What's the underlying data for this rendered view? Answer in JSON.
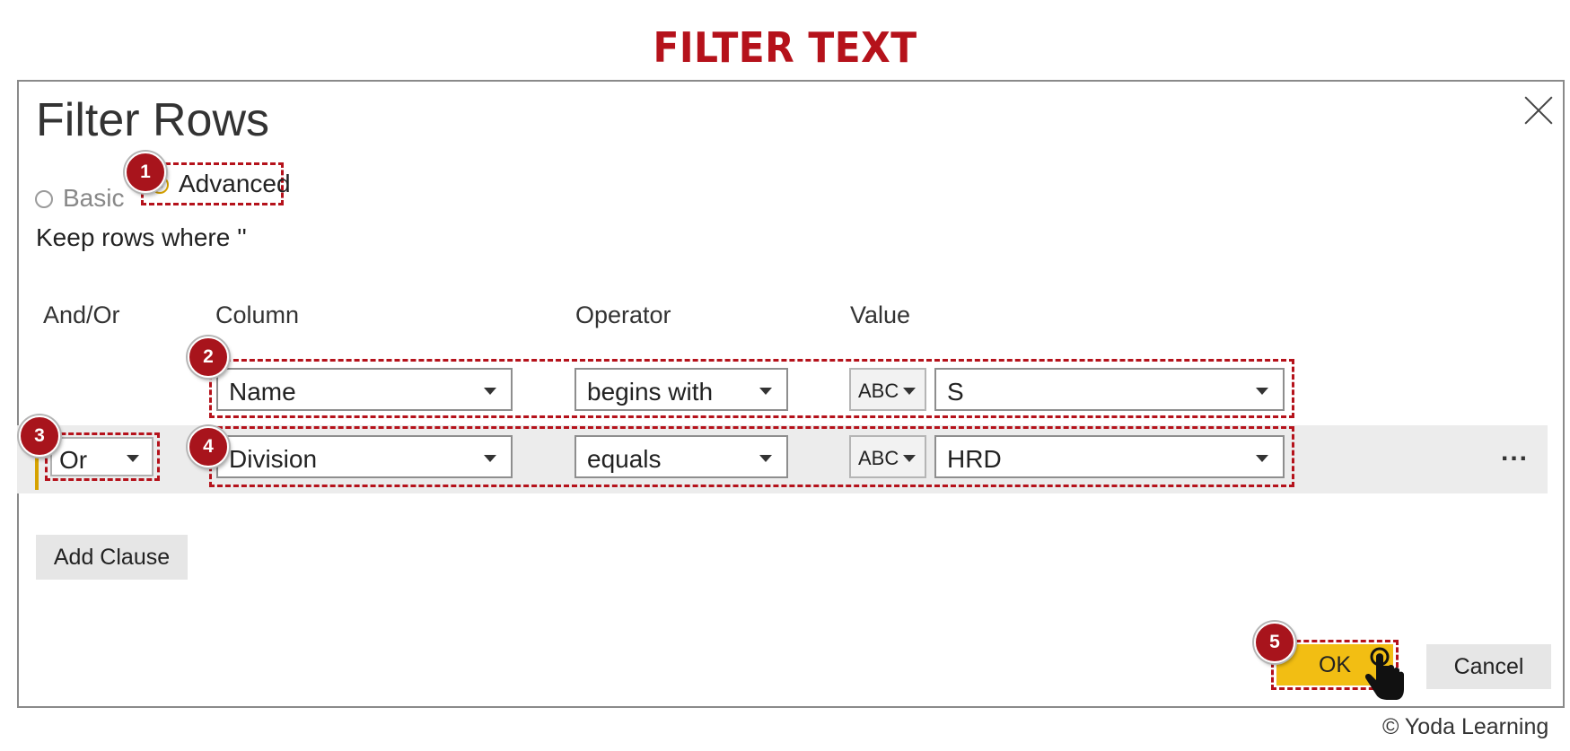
{
  "page_title": "FILTER TEXT",
  "dialog": {
    "title": "Filter Rows",
    "mode_basic_label": "Basic",
    "mode_advanced_label": "Advanced",
    "selected_mode": "Advanced",
    "keep_rows_label": "Keep rows where ''",
    "columns": {
      "and_or": "And/Or",
      "column": "Column",
      "operator": "Operator",
      "value": "Value"
    },
    "clauses": [
      {
        "and_or": "",
        "column": "Name",
        "type_icon": "ABC",
        "operator": "begins with",
        "value": "S"
      },
      {
        "and_or": "Or",
        "column": "Division",
        "type_icon": "ABC",
        "operator": "equals",
        "value": "HRD"
      }
    ],
    "more_label": "...",
    "add_clause_label": "Add Clause",
    "ok_label": "OK",
    "cancel_label": "Cancel"
  },
  "steps": [
    "1",
    "2",
    "3",
    "4",
    "5"
  ],
  "copyright": "© Yoda Learning",
  "colors": {
    "title_red": "#b5121b",
    "badge_red": "#a8141c",
    "accent_yellow": "#f2be13"
  }
}
